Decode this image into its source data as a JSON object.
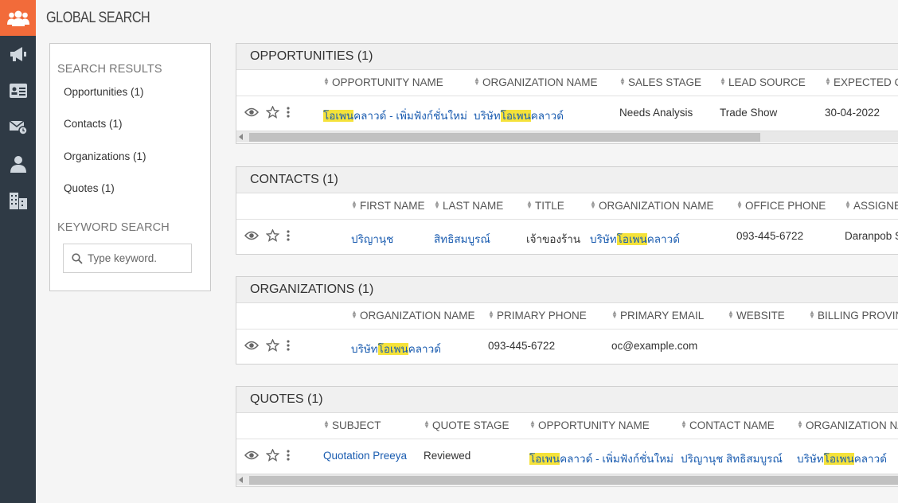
{
  "app": {
    "title": "GLOBAL SEARCH",
    "brand_color": "#f26b3a",
    "sidebar_color": "#2f3a45",
    "link_color": "#1a5cb0",
    "highlight_color": "#f5e23a"
  },
  "sidebar": {
    "items": [
      "users-group-icon",
      "megaphone-icon",
      "id-card-icon",
      "mail-clock-icon",
      "person-icon",
      "buildings-icon"
    ]
  },
  "left_panel": {
    "results_title": "SEARCH RESULTS",
    "links": [
      "Opportunities (1)",
      "Contacts (1)",
      "Organizations (1)",
      "Quotes (1)"
    ],
    "keyword_title": "KEYWORD SEARCH",
    "keyword_placeholder": "Type keyword."
  },
  "opportunities": {
    "title": "OPPORTUNITIES (1)",
    "columns": [
      "OPPORTUNITY NAME",
      "ORGANIZATION NAME",
      "SALES STAGE",
      "LEAD SOURCE",
      "EXPECTED CL"
    ],
    "row": {
      "opp_hl": "โอเพน",
      "opp_rest": "คลาวด์ - เพิ่มฟังก์ชั่นใหม่",
      "org_pre": "บริษัท",
      "org_hl": "โอเพน",
      "org_rest": "คลาวด์",
      "stage": "Needs Analysis",
      "source": "Trade Show",
      "date": "30-04-2022"
    }
  },
  "contacts": {
    "title": "CONTACTS (1)",
    "columns": [
      "FIRST NAME",
      "LAST NAME",
      "TITLE",
      "ORGANIZATION NAME",
      "OFFICE PHONE",
      "ASSIGNE"
    ],
    "row": {
      "first": "ปริญานุช",
      "last": "สิทธิสมบูรณ์",
      "title": "เจ้าของร้าน",
      "org_pre": "บริษัท",
      "org_hl": "โอเพน",
      "org_rest": "คลาวด์",
      "phone": "093-445-6722",
      "assigned": "Daranpob S"
    }
  },
  "organizations": {
    "title": "ORGANIZATIONS (1)",
    "columns": [
      "ORGANIZATION NAME",
      "PRIMARY PHONE",
      "PRIMARY EMAIL",
      "WEBSITE",
      "BILLING PROVIN"
    ],
    "row": {
      "org_pre": "บริษัท",
      "org_hl": "โอเพน",
      "org_rest": "คลาวด์",
      "phone": "093-445-6722",
      "email": "oc@example.com"
    }
  },
  "quotes": {
    "title": "QUOTES (1)",
    "columns": [
      "SUBJECT",
      "QUOTE STAGE",
      "OPPORTUNITY NAME",
      "CONTACT NAME",
      "ORGANIZATION NA"
    ],
    "row": {
      "subject": "Quotation Preeya",
      "stage": "Reviewed",
      "opp_hl": "โอเพน",
      "opp_rest": "คลาวด์ - เพิ่มฟังก์ชั่นใหม่",
      "contact": "ปริญานุช สิทธิสมบูรณ์",
      "org_pre": "บริษัท",
      "org_hl": "โอเพน",
      "org_rest": "คลาวด์"
    }
  }
}
